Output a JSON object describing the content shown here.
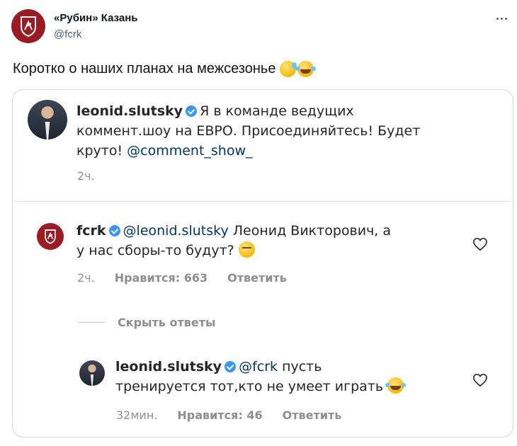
{
  "tweet": {
    "author_name": "«Рубин» Казань",
    "author_handle": "@fcrk",
    "text": "Коротко о наших планах на межсезонье",
    "emojis": [
      "grinning-sweat-emoji",
      "tears-of-joy-emoji"
    ]
  },
  "card": {
    "post": {
      "username": "leonid.slutsky",
      "caption": "Я в команде ведущих",
      "caption_line2": "коммент.шоу на ЕВРО. Присоединяйтесь! Будет",
      "caption_line3_prefix": "круто! ",
      "mention": "@comment_show_",
      "time": "2ч."
    },
    "comment": {
      "username": "fcrk",
      "mention": "@leonid.slutsky",
      "text": " Леонид Викторович, а",
      "text_line2": "у нас сборы-то будут?",
      "time": "2ч.",
      "likes": "Нравится: 663",
      "reply": "Ответить"
    },
    "hide_replies": "Скрыть ответы",
    "reply": {
      "username": "leonid.slutsky",
      "mention": "@fcrk",
      "text": " пусть",
      "text_line2": "тренируется тот,кто не умеет играть",
      "time": "32мин.",
      "likes": "Нравится: 46",
      "reply": "Ответить"
    }
  },
  "colors": {
    "club_red": "#9b1b24",
    "verified_blue": "#3897f0",
    "mention_blue": "#00376b",
    "meta_gray": "#8e8e8e"
  }
}
